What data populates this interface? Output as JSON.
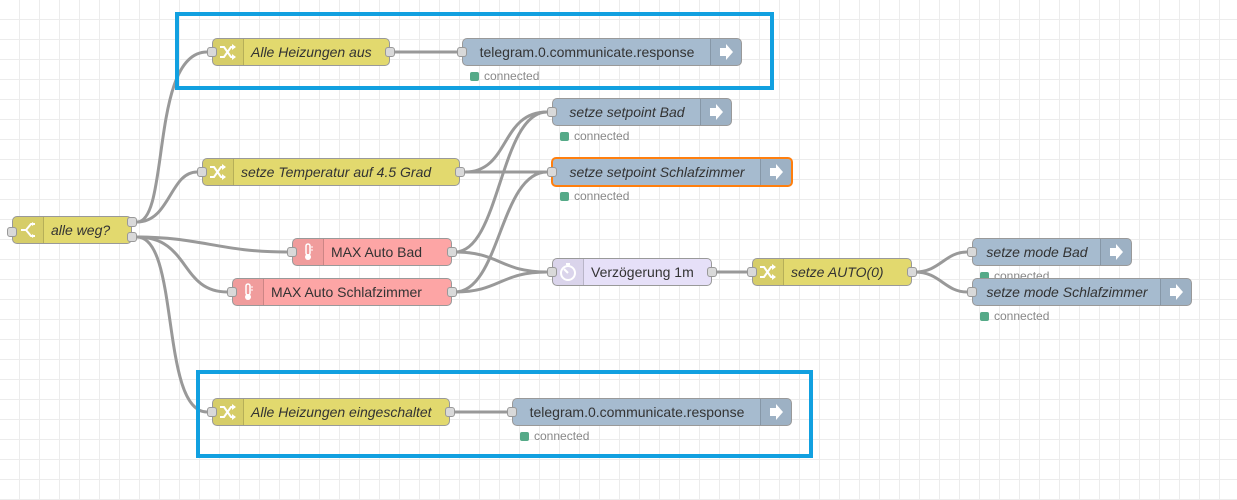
{
  "nodes": {
    "switch": {
      "label": "alle weg?"
    },
    "alle_aus": {
      "label": "Alle Heizungen aus"
    },
    "telegram_top": {
      "label": "telegram.0.communicate.response",
      "status": "connected"
    },
    "temp": {
      "label": "setze Temperatur auf 4.5 Grad"
    },
    "sp_bad": {
      "label": "setze setpoint Bad",
      "status": "connected"
    },
    "sp_schlaf": {
      "label": "setze setpoint Schlafzimmer",
      "status": "connected"
    },
    "max_bad": {
      "label": "MAX Auto Bad"
    },
    "max_schlaf": {
      "label": "MAX Auto Schlafzimmer"
    },
    "delay": {
      "label": "Verzögerung 1m"
    },
    "auto": {
      "label": "setze AUTO(0)"
    },
    "mode_bad": {
      "label": "setze mode Bad",
      "status": "connected"
    },
    "mode_schlaf": {
      "label": "setze mode Schlafzimmer",
      "status": "connected"
    },
    "alle_ein": {
      "label": "Alle Heizungen eingeschaltet"
    },
    "telegram_bottom": {
      "label": "telegram.0.communicate.response",
      "status": "connected"
    }
  },
  "colors": {
    "function": "#e2d96e",
    "output": "#a6bbcf",
    "max": "#fda5a5",
    "delay": "#e6e0f8",
    "highlight": "#11a0e0",
    "selected": "#ff7f0e",
    "status_ok": "#55aa88"
  },
  "icons": {
    "switch": "switch-icon",
    "change": "shuffle-icon",
    "output": "arrow-right-icon",
    "max": "thermometer-icon",
    "delay": "timer-icon"
  }
}
